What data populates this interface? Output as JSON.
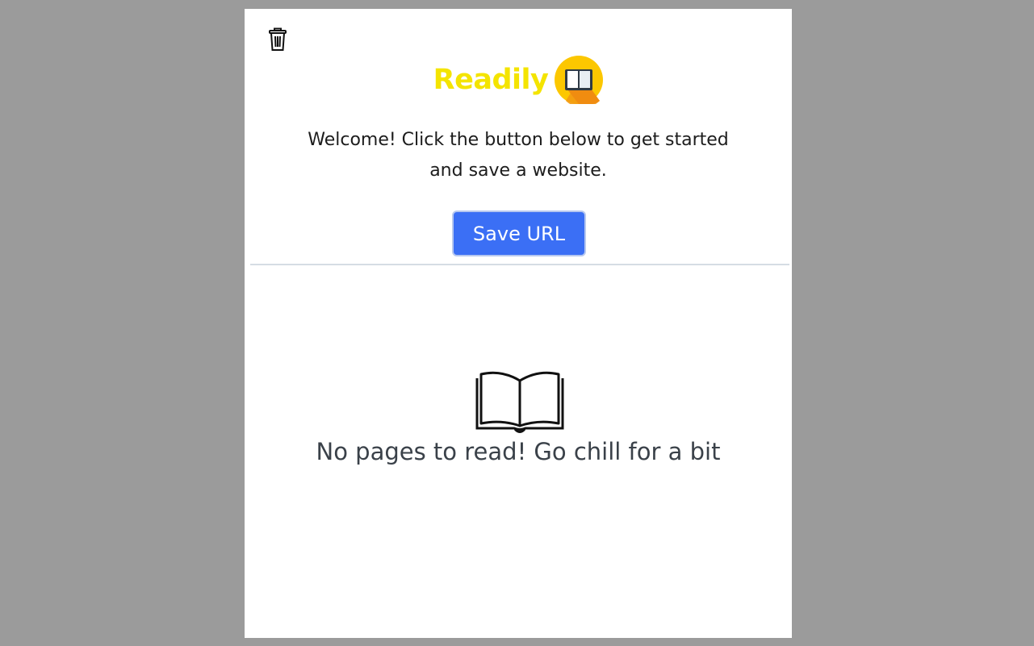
{
  "header": {
    "brand_title": "Readily",
    "brand_color": "#f4e400",
    "logo_icon": "book-emoji-icon",
    "trash_icon": "trash-icon"
  },
  "welcome": {
    "line1": "Welcome! Click the button below to get started",
    "line2": "and save a website."
  },
  "actions": {
    "save_label": "Save URL",
    "accent_color": "#3b6ff5"
  },
  "empty_state": {
    "icon": "open-book-icon",
    "message": "No pages to read! Go chill for a bit"
  }
}
